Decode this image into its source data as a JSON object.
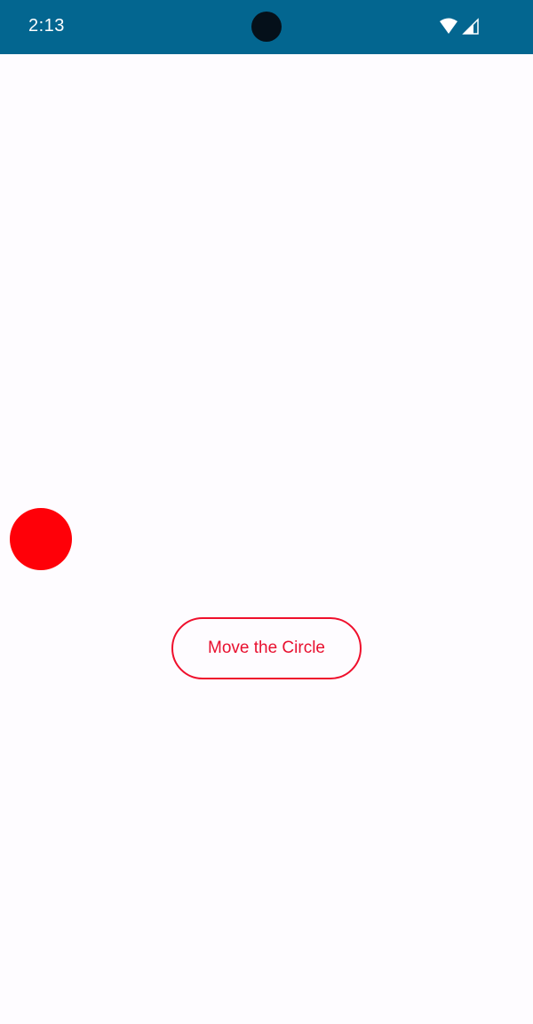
{
  "status_bar": {
    "time": "2:13",
    "icons": [
      "wifi-icon",
      "cellular-signal-icon"
    ],
    "background_color": "#036690"
  },
  "main": {
    "circle": {
      "color": "#ff0008"
    },
    "move_button": {
      "label": "Move the Circle",
      "accent_color": "#ef0f2c"
    }
  }
}
